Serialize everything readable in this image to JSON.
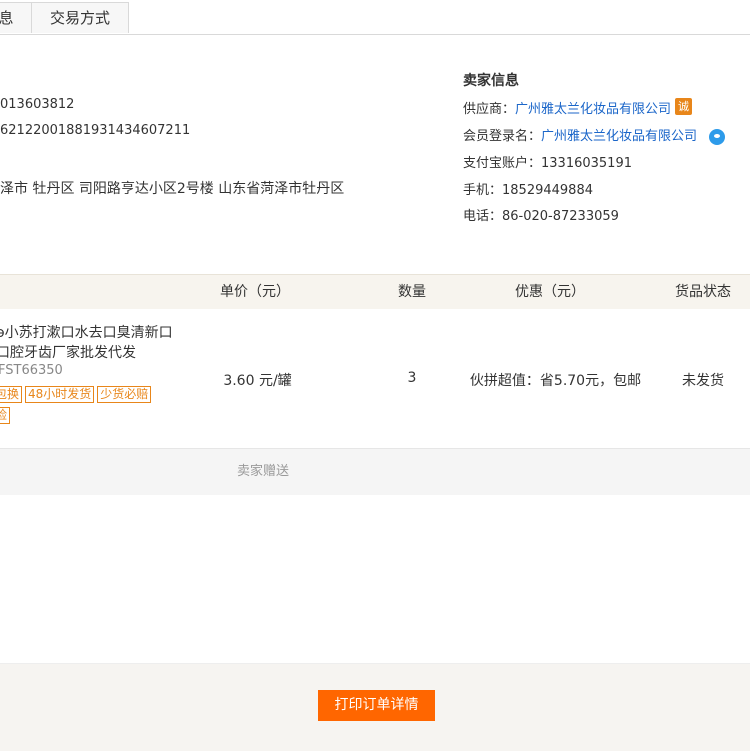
{
  "tabs": [
    {
      "label": "息"
    },
    {
      "label": "交易方式"
    }
  ],
  "buyer": {
    "line1": "013603812",
    "line2": "621220018819314346072​11",
    "address": "泽市 牡丹区 司阳路亨达小区2号楼 山东省菏泽市牡丹区"
  },
  "seller": {
    "title": "卖家信息",
    "supplier_label": "供应商：",
    "supplier": "广州雅太兰化妆品有限公司",
    "member_label": "会员登录名：",
    "member": "广州雅太兰化妆品有限公司",
    "alipay": "支付宝账户：13316035191",
    "mobile": "手机：18529449884",
    "phone": "电话：86-020-87233059",
    "cheng_icon_text": "诚"
  },
  "table": {
    "headers": [
      "单价（元）",
      "数量",
      "优惠（元）",
      "货品状态"
    ],
    "row": {
      "title": "ǝ小苏打漱口水去口臭清新口\n⁠́口腔牙齿厂家批发代发",
      "code": "FST66350",
      "tags": [
        "包换",
        "48小时发货",
        "少货必赔",
        "险"
      ],
      "price": "3.60 元/罐",
      "qty": "3",
      "discount": "伙拼超值：省5.70元，包邮",
      "status": "未发货"
    }
  },
  "gift_label": "卖家赠送",
  "print_button": "打印订单详情"
}
